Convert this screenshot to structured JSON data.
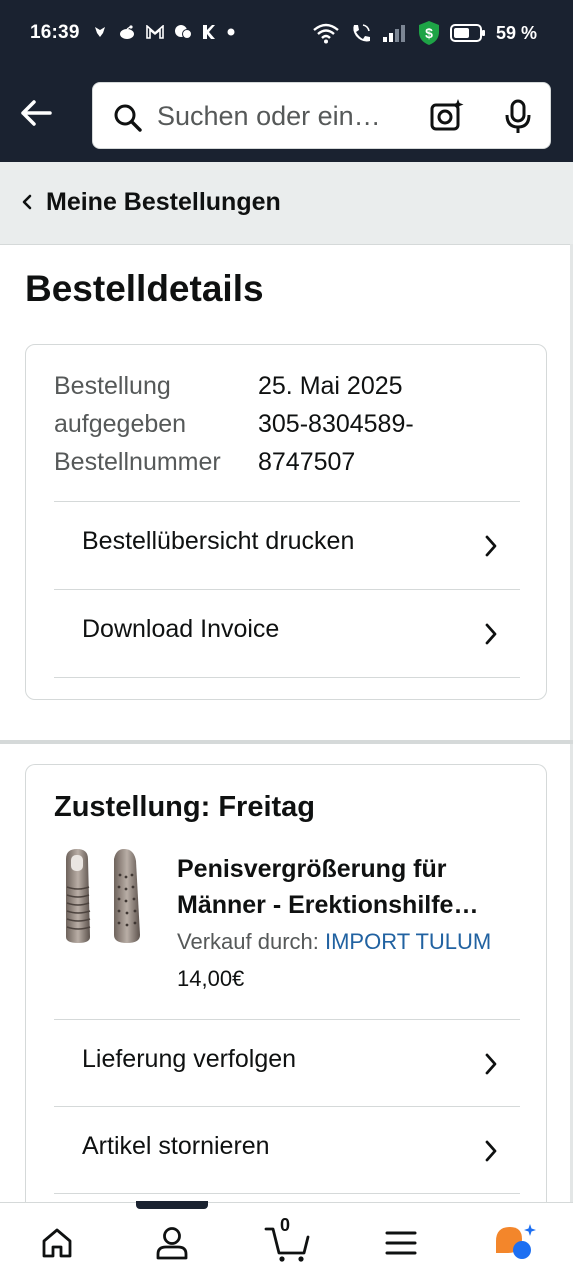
{
  "status_bar": {
    "time": "16:39",
    "battery_percent": "59 %",
    "icons": [
      "wifi-icon",
      "wifi-call-icon",
      "signal-icon",
      "security-shield-icon",
      "battery-icon"
    ],
    "notification_icons": [
      "app-notification-icon",
      "reddit-icon",
      "gmail-icon",
      "chat-icon",
      "k-app-icon",
      "dot-icon"
    ]
  },
  "search": {
    "placeholder": "Suchen oder ein…"
  },
  "subnav": {
    "back_label": "Meine Bestellungen"
  },
  "page": {
    "title": "Bestelldetails"
  },
  "order_info": {
    "labels": [
      "Bestellung",
      "aufgegeben",
      "Bestellnummer"
    ],
    "values": [
      "25. Mai 2025",
      "305-8304589-",
      "8747507"
    ]
  },
  "order_actions": [
    {
      "label": "Bestellübersicht drucken"
    },
    {
      "label": "Download Invoice"
    }
  ],
  "delivery": {
    "title": "Zustellung: Freitag",
    "product_title": "Penisvergrößerung für Männer - Erektionshilfe…",
    "sold_by_label": "Verkauf durch: ",
    "seller": "IMPORT TULUM",
    "price": "14,00€",
    "actions": [
      {
        "label": "Lieferung verfolgen"
      },
      {
        "label": "Artikel stornieren"
      }
    ]
  },
  "bottom_nav": {
    "cart_count": "0",
    "items": [
      "home-icon",
      "account-icon",
      "cart-icon",
      "menu-icon",
      "rufus-ai-icon"
    ]
  },
  "colors": {
    "header_bg": "#1a2230",
    "subnav_bg": "#eaeded",
    "link": "#2162a1",
    "shield_green": "#1ea446",
    "ai_orange": "#f3862b",
    "ai_blue": "#1d6ff2"
  }
}
